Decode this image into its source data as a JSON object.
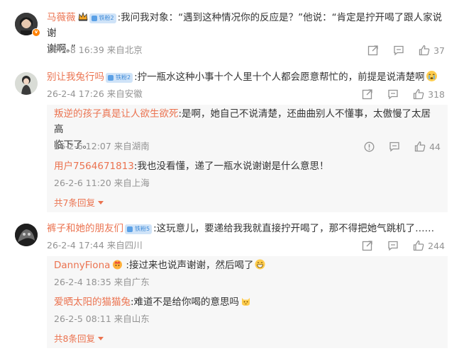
{
  "comments": [
    {
      "user": "马薇薇",
      "fan_badge": "铁粉2",
      "text": ":我问我对象：“遇到这种情况你的反应是？”他说：“肯定是拧开喝了跟人家说谢谢啊。”",
      "line1": ":我问我对象：“遇到这种情况你的反应是？”他说：“肯定是拧开喝了跟人家说谢",
      "line2": "谢啊。”",
      "time": "26-2-8 16:39 来自北京",
      "likes": "37"
    },
    {
      "user": "别让我兔行吗",
      "fan_badge": "铁粉2",
      "text": ":拧一瓶水这种小事十个人里十个人都会愿意帮忙的，前提是说清楚啊",
      "time": "26-2-4 17:26 来自安徽",
      "likes": "318",
      "replies": [
        {
          "user": "叛逆的孩子真是让人欲生欲死",
          "line1": ":是啊，她自己不说清楚，还曲曲别人不懂事，太傲慢了太居高",
          "line2": "临下了。",
          "time": "26-2-6 12:07 来自湖南",
          "likes": "44"
        },
        {
          "user": "用户7564671813",
          "text": ":我也没看懂，递了一瓶水说谢谢是什么意思！",
          "time": "26-2-6 11:20 来自上海"
        }
      ],
      "more_replies": "共7条回复"
    },
    {
      "user": "裤子和她的朋友们",
      "fan_badge": "铁粉5",
      "text": ":这玩意儿，要递给我我就直接拧开喝了，那不得把她气跳机了……",
      "time": "26-2-4 17:44 来自四川",
      "likes": "244",
      "replies": [
        {
          "user": "DannyFiona",
          "text": ":接过来也说声谢谢，然后喝了",
          "time": "26-2-4 18:35 来自广东"
        },
        {
          "user": "爱晒太阳的猫猫兔",
          "text": ":难道不是给你喝的意思吗",
          "time": "26-2-5 08:11 来自山东"
        }
      ],
      "more_replies": "共8条回复"
    }
  ]
}
